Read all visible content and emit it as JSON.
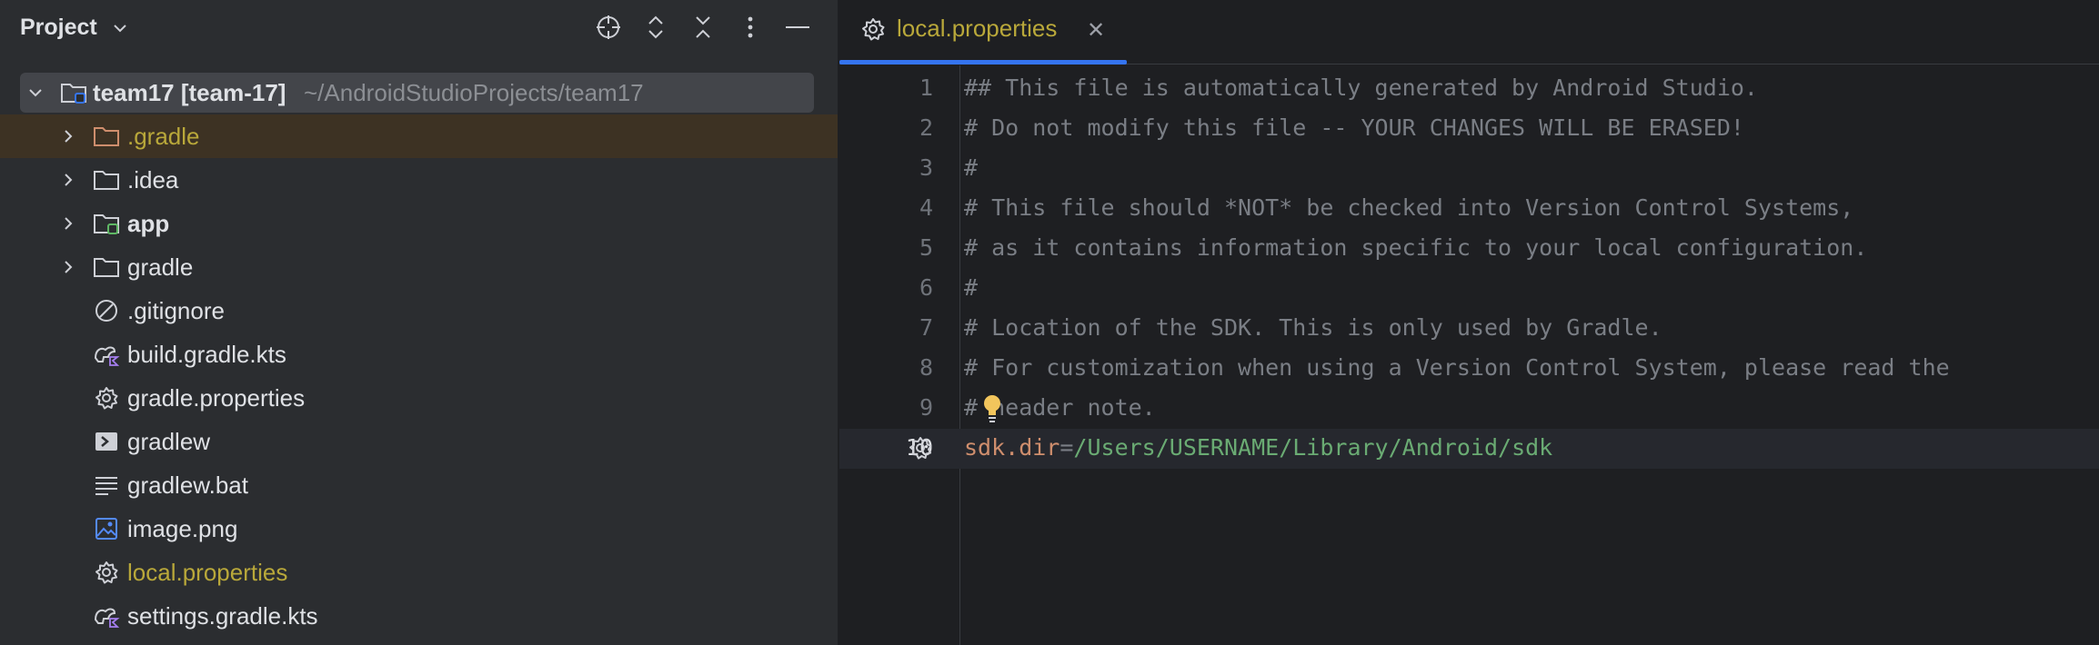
{
  "project_panel": {
    "title": "Project",
    "toolbar": [
      "locate-icon",
      "expand-all-icon",
      "collapse-all-icon",
      "more-icon",
      "hide-icon"
    ],
    "root": {
      "name": "team17 [team-17]",
      "path": "~/AndroidStudioProjects/team17"
    },
    "items": [
      {
        "label": ".gradle",
        "type": "folder",
        "expandable": true,
        "status": "modified"
      },
      {
        "label": ".idea",
        "type": "folder",
        "expandable": true
      },
      {
        "label": "app",
        "type": "module",
        "expandable": true
      },
      {
        "label": "gradle",
        "type": "folder",
        "expandable": true
      },
      {
        "label": ".gitignore",
        "type": "ignore-file"
      },
      {
        "label": "build.gradle.kts",
        "type": "gradle-kts"
      },
      {
        "label": "gradle.properties",
        "type": "properties"
      },
      {
        "label": "gradlew",
        "type": "script"
      },
      {
        "label": "gradlew.bat",
        "type": "text"
      },
      {
        "label": "image.png",
        "type": "image"
      },
      {
        "label": "local.properties",
        "type": "properties",
        "status": "modified"
      },
      {
        "label": "settings.gradle.kts",
        "type": "gradle-kts"
      }
    ]
  },
  "editor": {
    "tab": {
      "label": "local.properties",
      "icon": "gear-icon",
      "close": "✕"
    },
    "current_line": 10,
    "lines": [
      {
        "n": "1",
        "text": "## This file is automatically generated by Android Studio."
      },
      {
        "n": "2",
        "text": "# Do not modify this file -- YOUR CHANGES WILL BE ERASED!"
      },
      {
        "n": "3",
        "text": "#"
      },
      {
        "n": "4",
        "text": "# This file should *NOT* be checked into Version Control Systems,"
      },
      {
        "n": "5",
        "text": "# as it contains information specific to your local configuration."
      },
      {
        "n": "6",
        "text": "#"
      },
      {
        "n": "7",
        "text": "# Location of the SDK. This is only used by Gradle."
      },
      {
        "n": "8",
        "text": "# For customization when using a Version Control System, please read the"
      },
      {
        "n": "9",
        "text": "# header note."
      },
      {
        "n": "10",
        "key": "sdk.dir",
        "eq": "=",
        "value": "/Users/USERNAME/Library/Android/sdk"
      }
    ]
  },
  "colors": {
    "modified": "#b9a83a",
    "accent": "#3574f0",
    "property_key": "#cf8e6d",
    "property_value": "#6aab73"
  }
}
